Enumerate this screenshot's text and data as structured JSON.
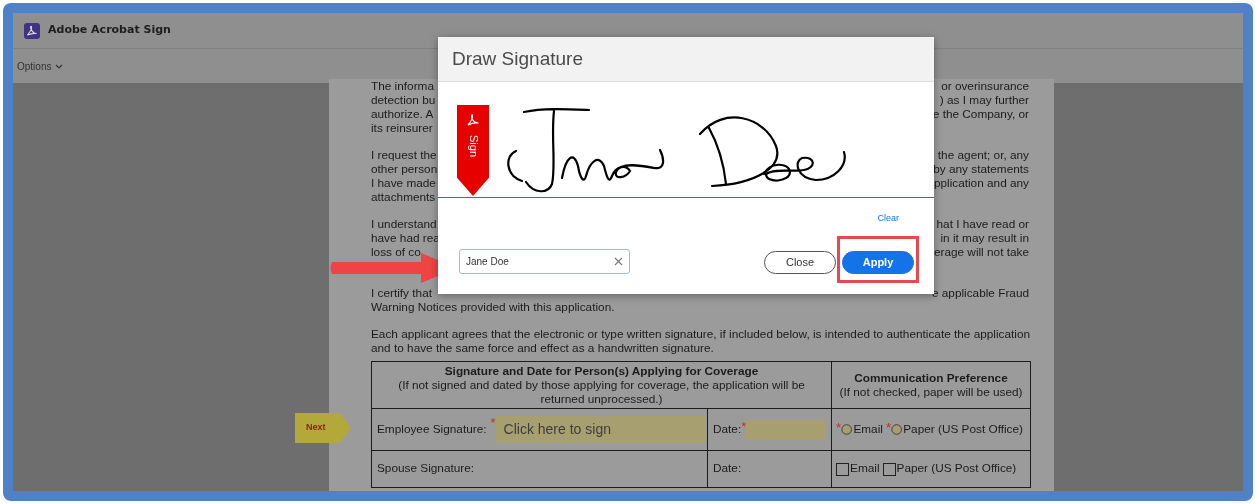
{
  "app": {
    "title": "Adobe Acrobat Sign"
  },
  "toolbar": {
    "menu": "Options"
  },
  "document": {
    "paragraphs": [
      {
        "lines": [
          {
            "left": "The informa",
            "right": "or overinsurance"
          },
          {
            "left": "detection bu",
            "right": ") as I may further"
          },
          {
            "left": "authorize. A",
            "right": "e the Company, or"
          },
          {
            "left": "its reinsurer"
          }
        ]
      },
      {
        "lines": [
          {
            "left": "I request the",
            "right": "the agent; or, any"
          },
          {
            "left": "other person",
            "right": "by any statements"
          },
          {
            "left": "I have made",
            "right": "pplication and any"
          },
          {
            "left": "attachments"
          }
        ]
      },
      {
        "lines": [
          {
            "left": "I understand",
            "right": "hat I have read or"
          },
          {
            "left": "have had rea",
            "right": "in it may result in"
          },
          {
            "left": "loss of co",
            "right": "erage will not take"
          }
        ]
      },
      {
        "lines": [
          {
            "left": "I certify that",
            "right": "e applicable Fraud"
          },
          {
            "left": "Warning Notices provided with this application."
          }
        ]
      },
      {
        "lines": [
          {
            "left": "Each applicant agrees that the electronic or type written signature, if included below, is intended to authenticate the application"
          },
          {
            "left": "and to have the same force and effect as a handwritten signature."
          }
        ]
      }
    ],
    "table": {
      "header": [
        {
          "title": "Signature and Date for Person(s) Applying for Coverage",
          "note": "(If not signed and dated by those applying for coverage, the application will be returned unprocessed.)"
        },
        {
          "title": "Communication Preference",
          "note": "(If not checked, paper will be used)"
        }
      ],
      "rows": [
        {
          "signature_label": "Employee Signature:",
          "signature_field": {
            "text": "Click here to sign",
            "required_mark": "*"
          },
          "date_label": "Date:",
          "date_field": {
            "required_mark": "*"
          },
          "options": [
            {
              "kind": "radio",
              "label": "Email",
              "checked": false,
              "required_mark": "*"
            },
            {
              "kind": "radio",
              "label": "Paper (US Post Office)",
              "checked": false,
              "required_mark": "*"
            }
          ]
        },
        {
          "signature_label": "Spouse Signature:",
          "date_label": "Date:",
          "options": [
            {
              "kind": "checkbox",
              "label": "Email",
              "checked": false
            },
            {
              "kind": "checkbox",
              "label": "Paper (US Post Office)",
              "checked": false
            }
          ]
        }
      ]
    }
  },
  "next_tag": "Next",
  "dialog": {
    "title": "Draw Signature",
    "ribbon_label": "Sign",
    "clear_link": "Clear",
    "name_field": {
      "value": "Jane Doe"
    },
    "buttons": [
      {
        "label": "Close",
        "kind": "secondary",
        "highlighted": false
      },
      {
        "label": "Apply",
        "kind": "primary",
        "highlighted": true
      }
    ]
  }
}
